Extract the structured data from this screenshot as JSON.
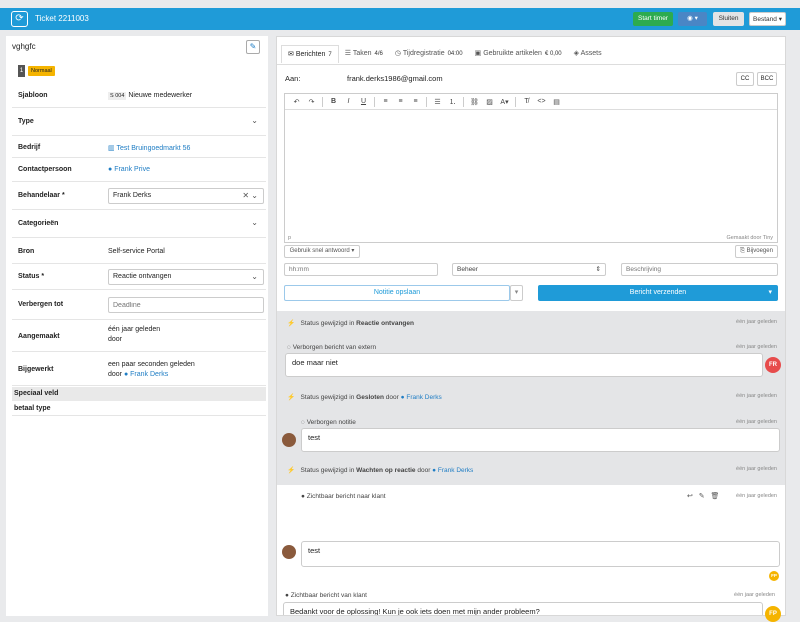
{
  "header": {
    "ticket": "Ticket 2211003",
    "start_timer": "Start timer",
    "close": "Sluiten",
    "file": "Bestand"
  },
  "left": {
    "name": "vghgfc",
    "badge_num": "1",
    "badge": "Normaal",
    "template_label": "Sjabloon",
    "template_code": "S 004",
    "template_value": "Nieuwe medewerker",
    "type_label": "Type",
    "company_label": "Bedrijf",
    "company_value": "Test Bruingoedmarkt 56",
    "contact_label": "Contactpersoon",
    "contact_value": "Frank Prive",
    "handler_label": "Behandelaar *",
    "handler_value": "Frank Derks",
    "categories_label": "Categorieën",
    "source_label": "Bron",
    "source_value": "Self-service Portal",
    "status_label": "Status *",
    "status_value": "Reactie ontvangen",
    "hide_label": "Verbergen tot",
    "hide_placeholder": "Deadline",
    "created_label": "Aangemaakt",
    "created_value": "één jaar geleden",
    "created_by": "door",
    "updated_label": "Bijgewerkt",
    "updated_value": "een paar seconden geleden",
    "updated_by": "door",
    "updated_user": "Frank Derks",
    "special": "Speciaal veld",
    "paytype": "betaal type"
  },
  "tabs": [
    {
      "label": "Berichten",
      "count": "7"
    },
    {
      "label": "Taken",
      "count": "4/6"
    },
    {
      "label": "Tijdregistratie",
      "count": "04:00"
    },
    {
      "label": "Gebruikte artikelen",
      "count": "€ 0,00"
    },
    {
      "label": "Assets",
      "count": ""
    }
  ],
  "compose": {
    "to_label": "Aan:",
    "to_value": "frank.derks1986@gmail.com",
    "cc": "CC",
    "bcc": "BCC",
    "powered": "Gemaakt door Tiny",
    "path": "p",
    "quick_answer": "Gebruik snel antwoord",
    "attachments": "Bijvoegen",
    "time_placeholder": "hh:mm",
    "manage": "Beheer",
    "desc_placeholder": "Beschrijving",
    "save_note": "Notitie opslaan",
    "send": "Bericht verzenden"
  },
  "timeline": [
    {
      "kind": "status",
      "text": "Status gewijzigd in",
      "status": "Reactie ontvangen",
      "time": "één jaar geleden"
    },
    {
      "kind": "label",
      "text": "Verborgen bericht van extern",
      "time": "één jaar geleden"
    },
    {
      "kind": "msg",
      "text": "doe maar niet",
      "avatar": "FR"
    },
    {
      "kind": "status",
      "text": "Status gewijzigd in",
      "status": "Gesloten",
      "by": "door",
      "user": "Frank Derks",
      "time": "één jaar geleden"
    },
    {
      "kind": "label",
      "text": "Verborgen notitie",
      "time": "één jaar geleden"
    },
    {
      "kind": "msg",
      "text": "test"
    },
    {
      "kind": "status",
      "text": "Status gewijzigd in",
      "status": "Wachten op reactie",
      "by": "door",
      "user": "Frank Derks",
      "time": "één jaar geleden"
    },
    {
      "kind": "label",
      "text": "Zichtbaar bericht naar klant",
      "time": "één jaar geleden"
    },
    {
      "kind": "msg",
      "text": "test",
      "avatar": "FP"
    },
    {
      "kind": "label",
      "text": "Zichtbaar bericht van klant",
      "time": "één jaar geleden"
    },
    {
      "kind": "msg",
      "text": "Bedankt voor de oplossing! Kun je ook iets doen met mijn ander probleem?",
      "avatar": "FP"
    }
  ],
  "colors": {
    "brand": "#1f9bd8",
    "green": "#2dab4f",
    "badge": "#f5b400",
    "avatar_red": "#e74c4c",
    "avatar_yellow": "#f5b400"
  }
}
